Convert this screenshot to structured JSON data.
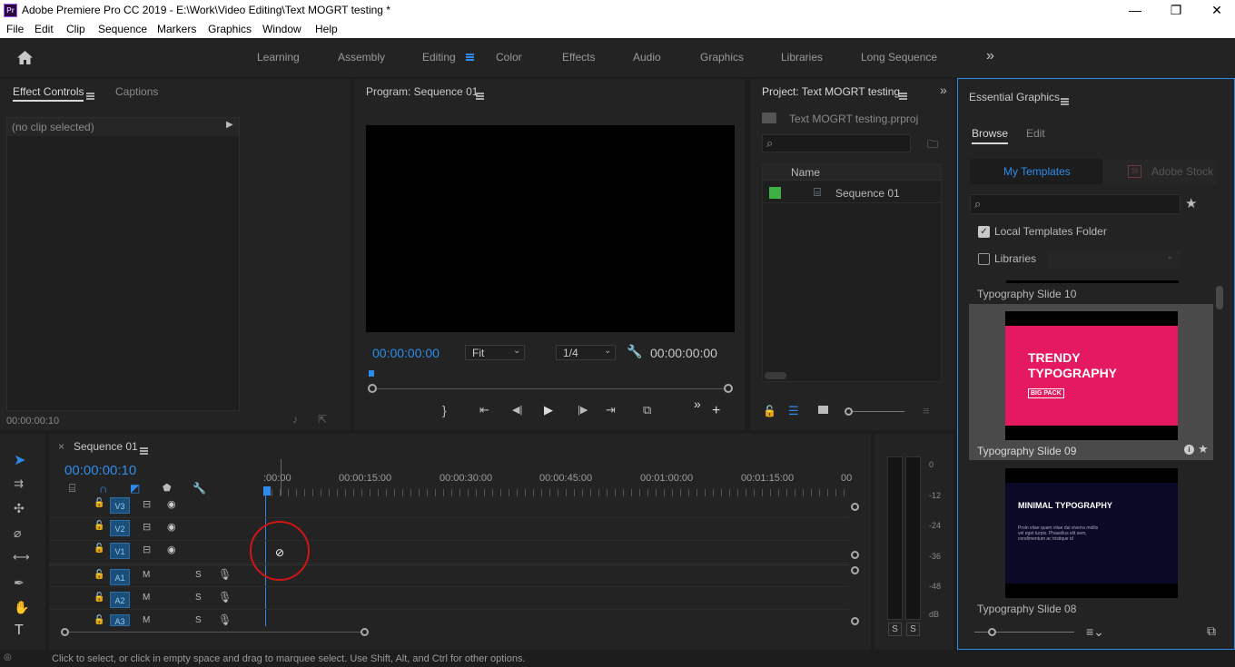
{
  "window": {
    "app_icon": "Pr",
    "title": "Adobe Premiere Pro CC 2019 - E:\\Work\\Video Editing\\Text MOGRT testing *"
  },
  "menu": [
    "File",
    "Edit",
    "Clip",
    "Sequence",
    "Markers",
    "Graphics",
    "Window",
    "Help"
  ],
  "workspaces": {
    "items": [
      "Learning",
      "Assembly",
      "Editing",
      "Color",
      "Effects",
      "Audio",
      "Graphics",
      "Libraries",
      "Long Sequence"
    ],
    "active": "Editing",
    "overflow": "»"
  },
  "effect_controls": {
    "tab1": "Effect Controls",
    "tab2": "Captions",
    "no_clip": "(no clip selected)",
    "timecode": "00:00:00:10"
  },
  "program": {
    "title": "Program: Sequence 01",
    "timecode_left": "00:00:00:00",
    "fit": "Fit",
    "resolution": "1/4",
    "timecode_right": "00:00:00:00"
  },
  "project": {
    "title": "Project: Text MOGRT testing",
    "file": "Text MOGRT testing.prproj",
    "col_name": "Name",
    "items": [
      {
        "name": "Sequence 01",
        "color": "#3cb043"
      }
    ]
  },
  "essential_graphics": {
    "title": "Essential Graphics",
    "tabs": [
      "Browse",
      "Edit"
    ],
    "active_tab": "Browse",
    "sources": [
      "My Templates",
      "Adobe Stock"
    ],
    "local_folder_label": "Local Templates Folder",
    "local_folder_checked": true,
    "libraries_label": "Libraries",
    "libraries_checked": false,
    "templates": [
      {
        "name": "Typography Slide 10"
      },
      {
        "name": "Typography Slide 09",
        "thumb_title": "TRENDY TYPOGRAPHY",
        "thumb_badge": "BIG PACK",
        "thumb_bg": "#e5195f"
      },
      {
        "name": "Typography Slide 08",
        "thumb_title": "MINIMAL TYPOGRAPHY",
        "thumb_body": "Proin vitae quam vitae dui viverra mollis vel eget turpis. Phasellus elit sem, condimentum ac tristique id",
        "thumb_bg": "#0a0a26"
      }
    ]
  },
  "timeline": {
    "tab": "Sequence 01",
    "timecode": "00:00:00:10",
    "ruler": [
      ":00:00",
      "00:00:15:00",
      "00:00:30:00",
      "00:00:45:00",
      "00:01:00:00",
      "00:01:15:00",
      "00"
    ],
    "video_tracks": [
      "V3",
      "V2",
      "V1"
    ],
    "audio_tracks": [
      "A1",
      "A2",
      "A3"
    ],
    "mute": "M",
    "solo": "S"
  },
  "meter": {
    "scale": [
      "0",
      "-12",
      "-24",
      "-36",
      "-48",
      "dB"
    ],
    "solo": [
      "S",
      "S"
    ]
  },
  "status": "Click to select, or click in empty space and drag to marquee select. Use Shift, Alt, and Ctrl for other options."
}
